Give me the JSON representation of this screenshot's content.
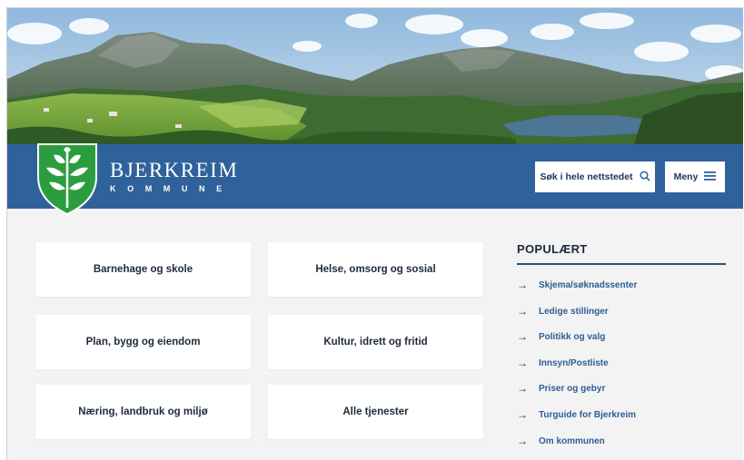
{
  "colors": {
    "header_blue": "#2f629b",
    "page_bg": "#f3f3f3",
    "link_blue": "#2d5d93",
    "shield_green": "#2c9d3e"
  },
  "brand": {
    "name": "BJERKREIM",
    "sub": "KOMMUNE"
  },
  "header": {
    "search_label": "Søk i hele nettstedet",
    "menu_label": "Meny",
    "search_icon": "search-icon",
    "menu_icon": "hamburger-icon"
  },
  "services": [
    {
      "label": "Barnehage og skole"
    },
    {
      "label": "Helse, omsorg og sosial"
    },
    {
      "label": "Plan, bygg og eiendom"
    },
    {
      "label": "Kultur, idrett og fritid"
    },
    {
      "label": "Næring, landbruk og miljø"
    },
    {
      "label": "Alle tjenester"
    }
  ],
  "popular": {
    "title": "POPULÆRT",
    "items": [
      {
        "label": "Skjema/søknadssenter"
      },
      {
        "label": "Ledige stillinger"
      },
      {
        "label": "Politikk og valg"
      },
      {
        "label": "Innsyn/Postliste"
      },
      {
        "label": "Priser og gebyr"
      },
      {
        "label": "Turguide for Bjerkreim"
      },
      {
        "label": "Om kommunen"
      }
    ]
  }
}
